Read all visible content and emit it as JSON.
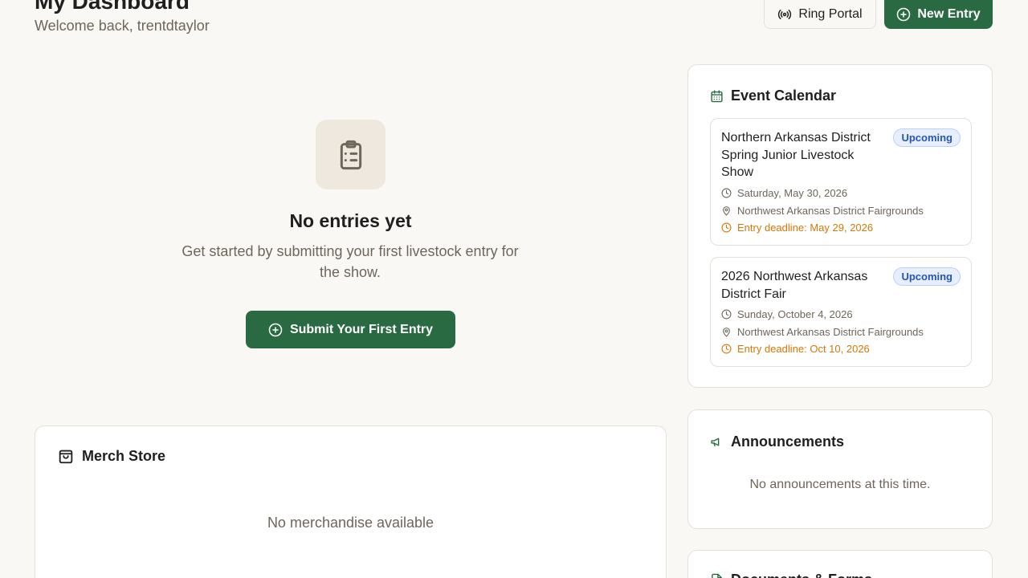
{
  "header": {
    "title": "My Dashboard",
    "welcome": "Welcome back, trentdtaylor",
    "ring_portal_label": "Ring Portal",
    "new_entry_label": "New Entry"
  },
  "icons": {
    "ring_portal": "broadcast-icon",
    "new_entry": "plus-circle-icon",
    "empty_state": "clipboard-list-icon",
    "submit": "plus-circle-icon",
    "merch": "shopping-bag-icon",
    "calendar": "calendar-icon",
    "clock": "clock-icon",
    "location": "map-pin-icon",
    "announcements": "megaphone-icon",
    "documents": "file-icon"
  },
  "colors": {
    "accent": "#2a6a43",
    "badge_text": "#2456b6",
    "deadline": "#d97706",
    "muted_text": "#6d6659"
  },
  "empty_state": {
    "title": "No entries yet",
    "text": "Get started by submitting your first livestock entry for the show.",
    "button_label": "Submit Your First Entry"
  },
  "merch": {
    "title": "Merch Store",
    "empty": "No merchandise available"
  },
  "calendar": {
    "title": "Event Calendar",
    "events": [
      {
        "name": "Northern Arkansas District Spring Junior Livestock Show",
        "status": "Upcoming",
        "date": "Saturday, May 30, 2026",
        "location": "Northwest Arkansas District Fairgrounds",
        "deadline": "Entry deadline: May 29, 2026"
      },
      {
        "name": "2026 Northwest Arkansas District Fair",
        "status": "Upcoming",
        "date": "Sunday, October 4, 2026",
        "location": "Northwest Arkansas District Fairgrounds",
        "deadline": "Entry deadline: Oct 10, 2026"
      }
    ]
  },
  "announcements": {
    "title": "Announcements",
    "empty": "No announcements at this time."
  },
  "documents": {
    "title": "Documents & Forms"
  }
}
